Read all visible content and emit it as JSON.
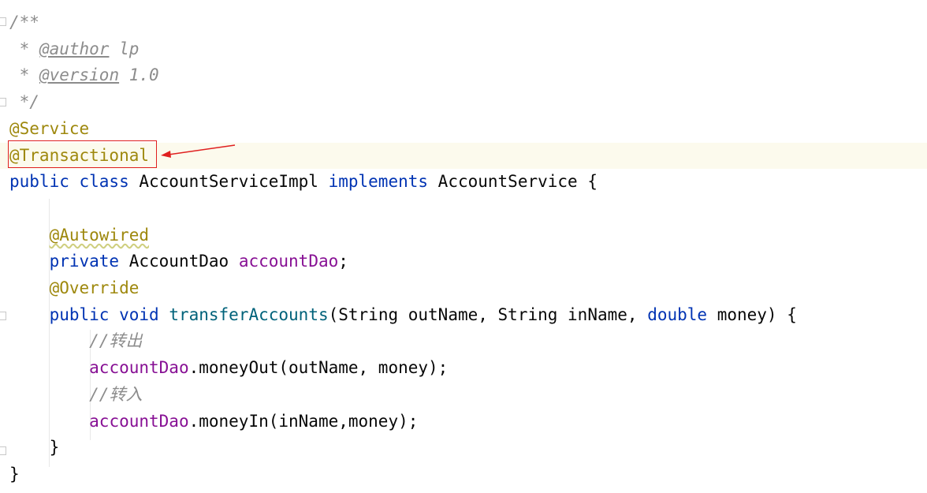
{
  "editor": {
    "lines": [
      {
        "segments": [
          {
            "t": "/**",
            "c": "cmt"
          }
        ]
      },
      {
        "segments": [
          {
            "t": " * ",
            "c": "cmt"
          },
          {
            "t": "@author",
            "c": "tag"
          },
          {
            "t": " lp",
            "c": "cmt"
          }
        ]
      },
      {
        "segments": [
          {
            "t": " * ",
            "c": "cmt"
          },
          {
            "t": "@version",
            "c": "tag"
          },
          {
            "t": " 1.0",
            "c": "cmt"
          }
        ]
      },
      {
        "segments": [
          {
            "t": " */",
            "c": "cmt"
          }
        ]
      },
      {
        "segments": [
          {
            "t": "@Service",
            "c": "ann"
          }
        ]
      },
      {
        "current": true,
        "segments": [
          {
            "t": "@Transactional",
            "c": "ann"
          }
        ]
      },
      {
        "segments": [
          {
            "t": "public class",
            "c": "kw"
          },
          {
            "t": " AccountServiceImpl ",
            "c": ""
          },
          {
            "t": "implements",
            "c": "kw"
          },
          {
            "t": " AccountService {",
            "c": ""
          }
        ]
      },
      {
        "segments": []
      },
      {
        "segments": [
          {
            "t": "    ",
            "c": ""
          },
          {
            "t": "@Autowired",
            "c": "ann warn"
          }
        ]
      },
      {
        "segments": [
          {
            "t": "    ",
            "c": ""
          },
          {
            "t": "private",
            "c": "kw"
          },
          {
            "t": " AccountDao ",
            "c": ""
          },
          {
            "t": "accountDao",
            "c": "field"
          },
          {
            "t": ";",
            "c": ""
          }
        ]
      },
      {
        "segments": [
          {
            "t": "    ",
            "c": ""
          },
          {
            "t": "@Override",
            "c": "ann"
          }
        ]
      },
      {
        "segments": [
          {
            "t": "    ",
            "c": ""
          },
          {
            "t": "public void",
            "c": "kw"
          },
          {
            "t": " ",
            "c": ""
          },
          {
            "t": "transferAccounts",
            "c": "method"
          },
          {
            "t": "(String outName, String inName, ",
            "c": ""
          },
          {
            "t": "double",
            "c": "kw"
          },
          {
            "t": " money) {",
            "c": ""
          }
        ]
      },
      {
        "segments": [
          {
            "t": "        ",
            "c": ""
          },
          {
            "t": "//转出",
            "c": "cmt"
          }
        ]
      },
      {
        "segments": [
          {
            "t": "        ",
            "c": ""
          },
          {
            "t": "accountDao",
            "c": "field"
          },
          {
            "t": ".moneyOut(outName, money);",
            "c": ""
          }
        ]
      },
      {
        "segments": [
          {
            "t": "        ",
            "c": ""
          },
          {
            "t": "//转入",
            "c": "cmt"
          }
        ]
      },
      {
        "segments": [
          {
            "t": "        ",
            "c": ""
          },
          {
            "t": "accountDao",
            "c": "field"
          },
          {
            "t": ".moneyIn(inName,money);",
            "c": ""
          }
        ]
      },
      {
        "segments": [
          {
            "t": "    }",
            "c": ""
          }
        ]
      },
      {
        "segments": [
          {
            "t": "}",
            "c": ""
          }
        ]
      }
    ]
  },
  "annotation": {
    "highlighted_line": "@Transactional",
    "highlight_color": "#e02020"
  }
}
